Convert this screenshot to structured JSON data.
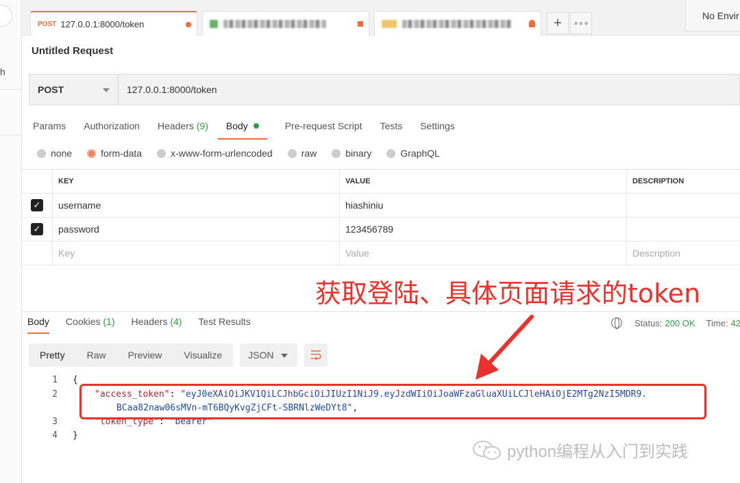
{
  "sidebar": {
    "fragment_text": "h"
  },
  "tabs": [
    {
      "method": "POST",
      "label": "127.0.0.1:8000/token",
      "active": true
    },
    {
      "method": "",
      "label": "",
      "active": false
    },
    {
      "method": "",
      "label": "",
      "active": false
    }
  ],
  "tab_tools": {
    "add": "+",
    "more": "∘∘∘"
  },
  "environment": {
    "label": "No Envir"
  },
  "request": {
    "title": "Untitled Request",
    "method": "POST",
    "url": "127.0.0.1:8000/token"
  },
  "request_tabs": {
    "params": "Params",
    "authorization": "Authorization",
    "headers": "Headers",
    "headers_count": "(9)",
    "body": "Body",
    "prerequest": "Pre-request Script",
    "tests": "Tests",
    "settings": "Settings"
  },
  "body_types": [
    "none",
    "form-data",
    "x-www-form-urlencoded",
    "raw",
    "binary",
    "GraphQL"
  ],
  "body_type_selected": "form-data",
  "kv_table": {
    "headers": {
      "key": "KEY",
      "value": "VALUE",
      "description": "DESCRIPTION"
    },
    "rows": [
      {
        "checked": true,
        "key": "username",
        "value": "hiashiniu",
        "description": ""
      },
      {
        "checked": true,
        "key": "password",
        "value": "123456789",
        "description": ""
      }
    ],
    "placeholders": {
      "key": "Key",
      "value": "Value",
      "description": "Description"
    }
  },
  "annotation": {
    "text": "获取登陆、具体页面请求的token",
    "color": "#e8322b"
  },
  "response_tabs": {
    "body": "Body",
    "cookies": "Cookies",
    "cookies_count": "(1)",
    "headers": "Headers",
    "headers_count": "(4)",
    "test_results": "Test Results"
  },
  "response_status": {
    "status_label": "Status:",
    "status_value": "200 OK",
    "time_label": "Time:",
    "time_value": "42"
  },
  "view_modes": [
    "Pretty",
    "Raw",
    "Preview",
    "Visualize"
  ],
  "view_mode_selected": "Pretty",
  "format": "JSON",
  "code": {
    "line_numbers": [
      "1",
      "2",
      "",
      "3",
      "4"
    ],
    "open_brace": "{",
    "close_brace": "}",
    "access_token_key": "\"access_token\"",
    "access_token_value_1": "\"eyJ0eXAiOiJKV1QiLCJhbGciOiJIUzI1NiJ9.eyJzdWIiOiJoaWFzaGluaXUiLCJleHAiOjE2MTg2NzI5MDR9.",
    "access_token_value_2": "BCaa82naw06sMVn-mT6BQyKvgZjCFt-SBRNlzWeDYt8\"",
    "token_type_key": "\"token_type\"",
    "token_type_value": "\"bearer\""
  },
  "watermark": {
    "text": "python编程从入门到实践"
  },
  "colors": {
    "accent": "#f26b3a",
    "success": "#2f9e44",
    "annotation": "#e8322b"
  }
}
